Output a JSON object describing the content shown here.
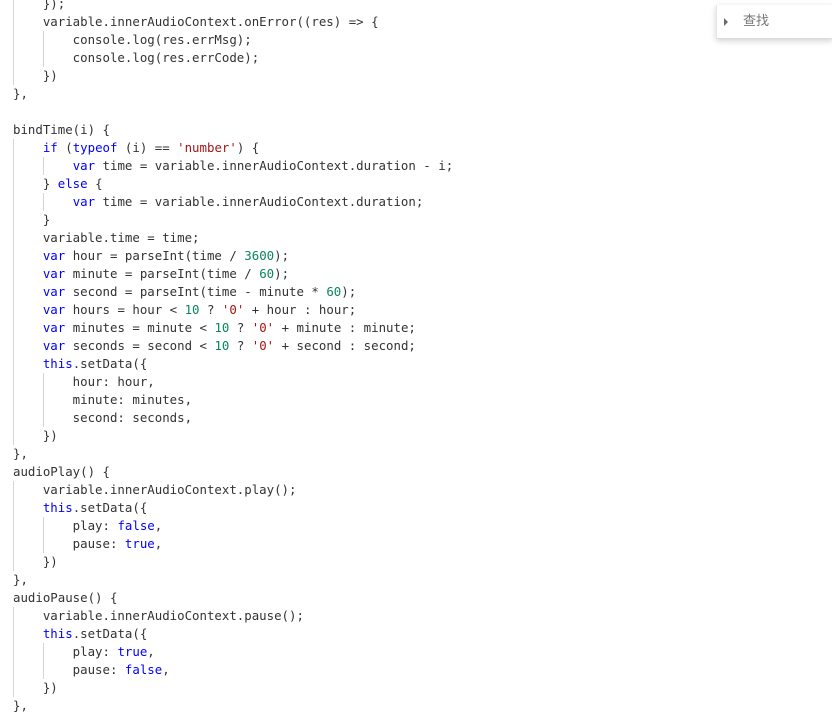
{
  "find_widget": {
    "placeholder": "查找"
  },
  "code_lines": [
    [
      [
        "    });",
        "plain"
      ]
    ],
    [
      [
        "    variable.innerAudioContext.onError((res) => {",
        "plain"
      ]
    ],
    [
      [
        "        console.log(res.errMsg);",
        "plain"
      ]
    ],
    [
      [
        "        console.log(res.errCode);",
        "plain"
      ]
    ],
    [
      [
        "    })",
        "plain"
      ]
    ],
    [
      [
        "},",
        "plain"
      ]
    ],
    [
      [
        "",
        "plain"
      ]
    ],
    [
      [
        "bindTime(i) {",
        "plain"
      ]
    ],
    [
      [
        "    ",
        "plain"
      ],
      [
        "if",
        "kw"
      ],
      [
        " (",
        "plain"
      ],
      [
        "typeof",
        "kw"
      ],
      [
        " (i) == ",
        "plain"
      ],
      [
        "'number'",
        "str"
      ],
      [
        ") {",
        "plain"
      ]
    ],
    [
      [
        "        ",
        "plain"
      ],
      [
        "var",
        "kw"
      ],
      [
        " time = variable.innerAudioContext.duration - i;",
        "plain"
      ]
    ],
    [
      [
        "    } ",
        "plain"
      ],
      [
        "else",
        "kw"
      ],
      [
        " {",
        "plain"
      ]
    ],
    [
      [
        "        ",
        "plain"
      ],
      [
        "var",
        "kw"
      ],
      [
        " time = variable.innerAudioContext.duration;",
        "plain"
      ]
    ],
    [
      [
        "    }",
        "plain"
      ]
    ],
    [
      [
        "    variable.time = time;",
        "plain"
      ]
    ],
    [
      [
        "    ",
        "plain"
      ],
      [
        "var",
        "kw"
      ],
      [
        " hour = parseInt(time / ",
        "plain"
      ],
      [
        "3600",
        "num"
      ],
      [
        ");",
        "plain"
      ]
    ],
    [
      [
        "    ",
        "plain"
      ],
      [
        "var",
        "kw"
      ],
      [
        " minute = parseInt(time / ",
        "plain"
      ],
      [
        "60",
        "num"
      ],
      [
        ");",
        "plain"
      ]
    ],
    [
      [
        "    ",
        "plain"
      ],
      [
        "var",
        "kw"
      ],
      [
        " second = parseInt(time - minute * ",
        "plain"
      ],
      [
        "60",
        "num"
      ],
      [
        ");",
        "plain"
      ]
    ],
    [
      [
        "    ",
        "plain"
      ],
      [
        "var",
        "kw"
      ],
      [
        " hours = hour < ",
        "plain"
      ],
      [
        "10",
        "num"
      ],
      [
        " ? ",
        "plain"
      ],
      [
        "'0'",
        "str"
      ],
      [
        " + hour : hour;",
        "plain"
      ]
    ],
    [
      [
        "    ",
        "plain"
      ],
      [
        "var",
        "kw"
      ],
      [
        " minutes = minute < ",
        "plain"
      ],
      [
        "10",
        "num"
      ],
      [
        " ? ",
        "plain"
      ],
      [
        "'0'",
        "str"
      ],
      [
        " + minute : minute;",
        "plain"
      ]
    ],
    [
      [
        "    ",
        "plain"
      ],
      [
        "var",
        "kw"
      ],
      [
        " seconds = second < ",
        "plain"
      ],
      [
        "10",
        "num"
      ],
      [
        " ? ",
        "plain"
      ],
      [
        "'0'",
        "str"
      ],
      [
        " + second : second;",
        "plain"
      ]
    ],
    [
      [
        "    ",
        "plain"
      ],
      [
        "this",
        "kw"
      ],
      [
        ".setData({",
        "plain"
      ]
    ],
    [
      [
        "        hour: hour,",
        "plain"
      ]
    ],
    [
      [
        "        minute: minutes,",
        "plain"
      ]
    ],
    [
      [
        "        second: seconds,",
        "plain"
      ]
    ],
    [
      [
        "    })",
        "plain"
      ]
    ],
    [
      [
        "},",
        "plain"
      ]
    ],
    [
      [
        "audioPlay() {",
        "plain"
      ]
    ],
    [
      [
        "    variable.innerAudioContext.play();",
        "plain"
      ]
    ],
    [
      [
        "    ",
        "plain"
      ],
      [
        "this",
        "kw"
      ],
      [
        ".setData({",
        "plain"
      ]
    ],
    [
      [
        "        play: ",
        "plain"
      ],
      [
        "false",
        "kw"
      ],
      [
        ",",
        "plain"
      ]
    ],
    [
      [
        "        pause: ",
        "plain"
      ],
      [
        "true",
        "kw"
      ],
      [
        ",",
        "plain"
      ]
    ],
    [
      [
        "    })",
        "plain"
      ]
    ],
    [
      [
        "},",
        "plain"
      ]
    ],
    [
      [
        "audioPause() {",
        "plain"
      ]
    ],
    [
      [
        "    variable.innerAudioContext.pause();",
        "plain"
      ]
    ],
    [
      [
        "    ",
        "plain"
      ],
      [
        "this",
        "kw"
      ],
      [
        ".setData({",
        "plain"
      ]
    ],
    [
      [
        "        play: ",
        "plain"
      ],
      [
        "true",
        "kw"
      ],
      [
        ",",
        "plain"
      ]
    ],
    [
      [
        "        pause: ",
        "plain"
      ],
      [
        "false",
        "kw"
      ],
      [
        ",",
        "plain"
      ]
    ],
    [
      [
        "    })",
        "plain"
      ]
    ],
    [
      [
        "},",
        "plain"
      ]
    ]
  ]
}
